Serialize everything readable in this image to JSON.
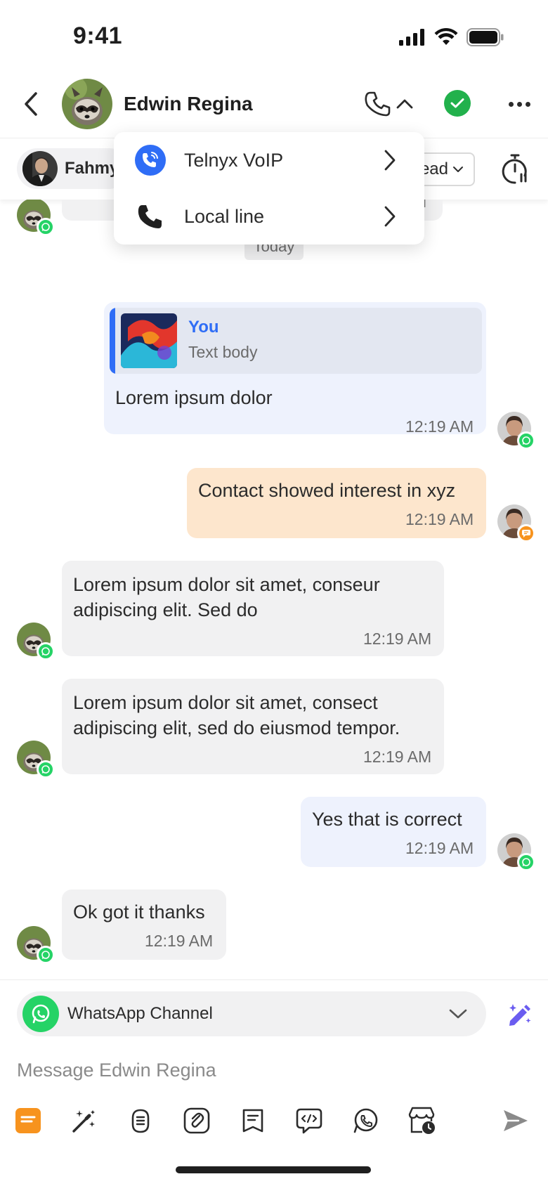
{
  "status_bar": {
    "time": "9:41"
  },
  "header": {
    "contact_name": "Edwin Regina"
  },
  "subbar": {
    "agent_name": "Fahmy",
    "lead_label": "ead"
  },
  "call_menu": {
    "items": [
      {
        "label": "Telnyx VoIP",
        "icon": "voip-phone-icon"
      },
      {
        "label": "Local line",
        "icon": "phone-icon"
      }
    ]
  },
  "partial_time": "M",
  "date_divider": "Today",
  "messages": [
    {
      "direction": "outgoing",
      "reply_author": "You",
      "reply_body": "Text body",
      "text": "Lorem ipsum dolor",
      "time": "12:19 AM",
      "channel": "whatsapp"
    },
    {
      "direction": "note",
      "text": "Contact showed interest in xyz",
      "time": "12:19 AM",
      "channel": "note"
    },
    {
      "direction": "incoming",
      "lines": [
        "Lorem ipsum dolor sit amet, conseur",
        "adipiscing elit. Sed do"
      ],
      "time": "12:19 AM",
      "channel": "whatsapp"
    },
    {
      "direction": "incoming",
      "lines": [
        "Lorem ipsum dolor sit amet, consect",
        "adipiscing elit, sed do eiusmod tempor."
      ],
      "time": "12:19 AM",
      "channel": "whatsapp"
    },
    {
      "direction": "outgoing",
      "text": "Yes that is correct",
      "time": "12:19 AM",
      "channel": "whatsapp"
    },
    {
      "direction": "incoming",
      "text": "Ok got it thanks",
      "time": "12:19 AM",
      "channel": "whatsapp"
    }
  ],
  "composer": {
    "channel_label": "WhatsApp Channel",
    "placeholder": "Message Edwin Regina",
    "toolbar_icons": [
      "notes-icon",
      "magic-wand-icon",
      "voice-memo-icon",
      "attachment-icon",
      "template-icon",
      "snippet-icon",
      "whatsapp-icon",
      "store-icon"
    ]
  },
  "colors": {
    "accent_blue": "#2f6df6",
    "whatsapp_green": "#25d366",
    "note_bubble": "#fde6cd",
    "outgoing_bubble": "#eef2fd",
    "incoming_bubble": "#f1f1f2",
    "status_green": "#22b14c",
    "note_orange": "#f7931e"
  }
}
